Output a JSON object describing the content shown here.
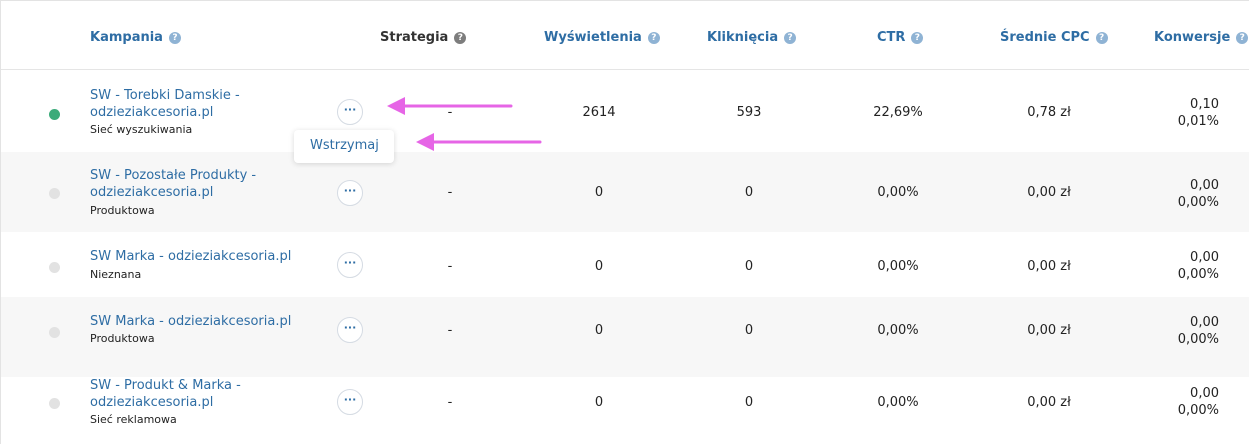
{
  "header": {
    "kampania": "Kampania",
    "strategia": "Strategia",
    "wyswietlenia": "Wyświetlenia",
    "klikniecia": "Kliknięcia",
    "ctr": "CTR",
    "cpc": "Średnie CPC",
    "konwersje": "Konwersje",
    "help": "?"
  },
  "more_label": "···",
  "dropdown": {
    "pause_label": "Wstrzymaj"
  },
  "rows": [
    {
      "status": "active",
      "name": "SW - Torebki Damskie - odzieziakcesoria.pl",
      "type": "Sieć wyszukiwania",
      "strategy": "-",
      "impressions": "2614",
      "clicks": "593",
      "ctr": "22,69%",
      "cpc": "0,78 zł",
      "conv_value": "0,10",
      "conv_rate": "0,01%"
    },
    {
      "status": "inactive",
      "name": "SW - Pozostałe Produkty - odzieziakcesoria.pl",
      "type": "Produktowa",
      "strategy": "-",
      "impressions": "0",
      "clicks": "0",
      "ctr": "0,00%",
      "cpc": "0,00 zł",
      "conv_value": "0,00",
      "conv_rate": "0,00%"
    },
    {
      "status": "inactive",
      "name": "SW Marka - odzieziakcesoria.pl",
      "type": "Nieznana",
      "strategy": "-",
      "impressions": "0",
      "clicks": "0",
      "ctr": "0,00%",
      "cpc": "0,00 zł",
      "conv_value": "0,00",
      "conv_rate": "0,00%"
    },
    {
      "status": "inactive",
      "name": "SW Marka - odzieziakcesoria.pl",
      "type": "Produktowa",
      "strategy": "-",
      "impressions": "0",
      "clicks": "0",
      "ctr": "0,00%",
      "cpc": "0,00 zł",
      "conv_value": "0,00",
      "conv_rate": "0,00%"
    },
    {
      "status": "inactive",
      "name": "SW - Produkt & Marka - odzieziakcesoria.pl",
      "type": "Sieć reklamowa",
      "strategy": "-",
      "impressions": "0",
      "clicks": "0",
      "ctr": "0,00%",
      "cpc": "0,00 zł",
      "conv_value": "0,00",
      "conv_rate": "0,00%"
    }
  ],
  "colors": {
    "link": "#2e6da4",
    "active": "#3bab7a",
    "inactive": "#e2e2e2",
    "annotation_arrow": "#e665e6"
  }
}
